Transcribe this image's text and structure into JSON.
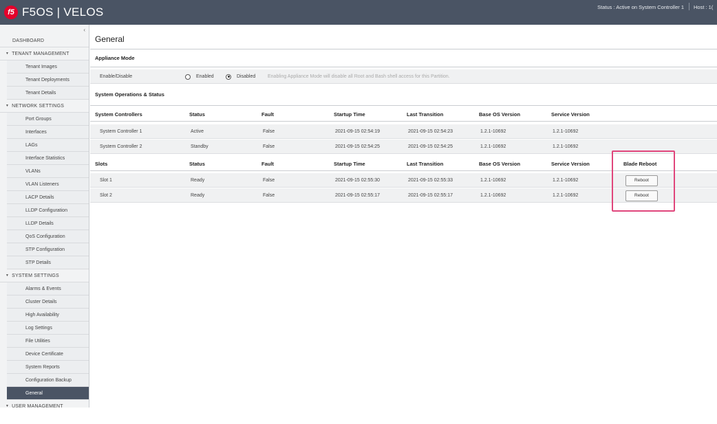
{
  "header": {
    "logo_text": "f5",
    "title": "F5OS | VELOS",
    "status": "Status : Active on System Controller 1",
    "host": "Host : 1("
  },
  "sidebar": {
    "collapse_glyph": "‹",
    "items": [
      {
        "label": "DASHBOARD",
        "type": "section",
        "first": true
      },
      {
        "label": "TENANT MANAGEMENT",
        "type": "section",
        "expanded": true
      },
      {
        "label": "Tenant Images",
        "type": "sub"
      },
      {
        "label": "Tenant Deployments",
        "type": "sub"
      },
      {
        "label": "Tenant Details",
        "type": "sub"
      },
      {
        "label": "NETWORK SETTINGS",
        "type": "section",
        "expanded": true
      },
      {
        "label": "Port Groups",
        "type": "sub"
      },
      {
        "label": "Interfaces",
        "type": "sub"
      },
      {
        "label": "LAGs",
        "type": "sub"
      },
      {
        "label": "Interface Statistics",
        "type": "sub"
      },
      {
        "label": "VLANs",
        "type": "sub"
      },
      {
        "label": "VLAN Listeners",
        "type": "sub"
      },
      {
        "label": "LACP Details",
        "type": "sub"
      },
      {
        "label": "LLDP Configuration",
        "type": "sub"
      },
      {
        "label": "LLDP Details",
        "type": "sub"
      },
      {
        "label": "QoS Configuration",
        "type": "sub"
      },
      {
        "label": "STP Configuration",
        "type": "sub"
      },
      {
        "label": "STP Details",
        "type": "sub"
      },
      {
        "label": "SYSTEM SETTINGS",
        "type": "section",
        "expanded": true
      },
      {
        "label": "Alarms & Events",
        "type": "sub"
      },
      {
        "label": "Cluster Details",
        "type": "sub"
      },
      {
        "label": "High Availability",
        "type": "sub"
      },
      {
        "label": "Log Settings",
        "type": "sub"
      },
      {
        "label": "File Utilities",
        "type": "sub"
      },
      {
        "label": "Device Certificate",
        "type": "sub"
      },
      {
        "label": "System Reports",
        "type": "sub"
      },
      {
        "label": "Configuration Backup",
        "type": "sub"
      },
      {
        "label": "General",
        "type": "sub",
        "active": true
      },
      {
        "label": "USER MANAGEMENT",
        "type": "section",
        "expanded": true
      }
    ]
  },
  "main": {
    "title": "General",
    "appliance": {
      "heading": "Appliance Mode",
      "row_label": "Enable/Disable",
      "enabled_label": "Enabled",
      "disabled_label": "Disabled",
      "selected": "Disabled",
      "hint": "Enabling Appliance Mode will disable all Root and Bash shell access for this Partition."
    },
    "ops_heading": "System Operations & Status",
    "controllers": {
      "headers": [
        "System Controllers",
        "Status",
        "Fault",
        "Startup Time",
        "Last Transition",
        "Base OS Version",
        "Service Version"
      ],
      "rows": [
        [
          "System Controller 1",
          "Active",
          "False",
          "2021-09-15 02:54:19",
          "2021-09-15 02:54:23",
          "1.2.1-10692",
          "1.2.1-10692"
        ],
        [
          "System Controller 2",
          "Standby",
          "False",
          "2021-09-15 02:54:25",
          "2021-09-15 02:54:25",
          "1.2.1-10692",
          "1.2.1-10692"
        ]
      ]
    },
    "slots": {
      "headers": [
        "Slots",
        "Status",
        "Fault",
        "Startup Time",
        "Last Transition",
        "Base OS Version",
        "Service Version",
        "Blade Reboot"
      ],
      "rows": [
        [
          "Slot 1",
          "Ready",
          "False",
          "2021-09-15 02:55:30",
          "2021-09-15 02:55:33",
          "1.2.1-10692",
          "1.2.1-10692"
        ],
        [
          "Slot 2",
          "Ready",
          "False",
          "2021-09-15 02:55:17",
          "2021-09-15 02:55:17",
          "1.2.1-10692",
          "1.2.1-10692"
        ]
      ],
      "reboot_label": "Reboot"
    },
    "highlight_color": "#e0457b"
  }
}
